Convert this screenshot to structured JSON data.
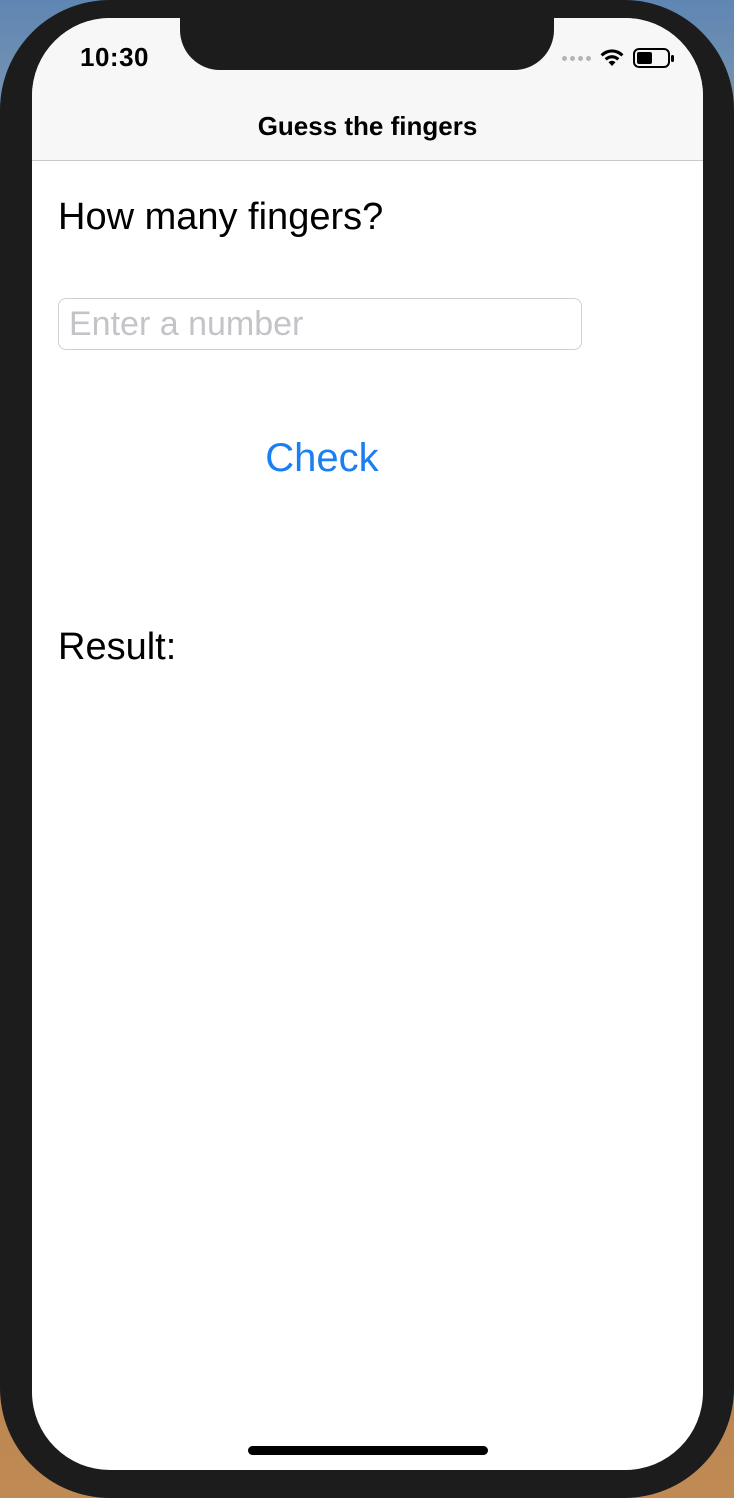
{
  "status_bar": {
    "time": "10:30"
  },
  "nav": {
    "title": "Guess the fingers"
  },
  "main": {
    "question": "How many fingers?",
    "input": {
      "value": "",
      "placeholder": "Enter a number"
    },
    "check_label": "Check",
    "result_label": "Result:"
  },
  "colors": {
    "accent": "#1a7ff2",
    "nav_background": "#f7f7f7",
    "placeholder": "#c4c4c8"
  },
  "icons": {
    "signal": "signal-icon",
    "wifi": "wifi-icon",
    "battery": "battery-icon"
  },
  "battery_level": 0.5
}
